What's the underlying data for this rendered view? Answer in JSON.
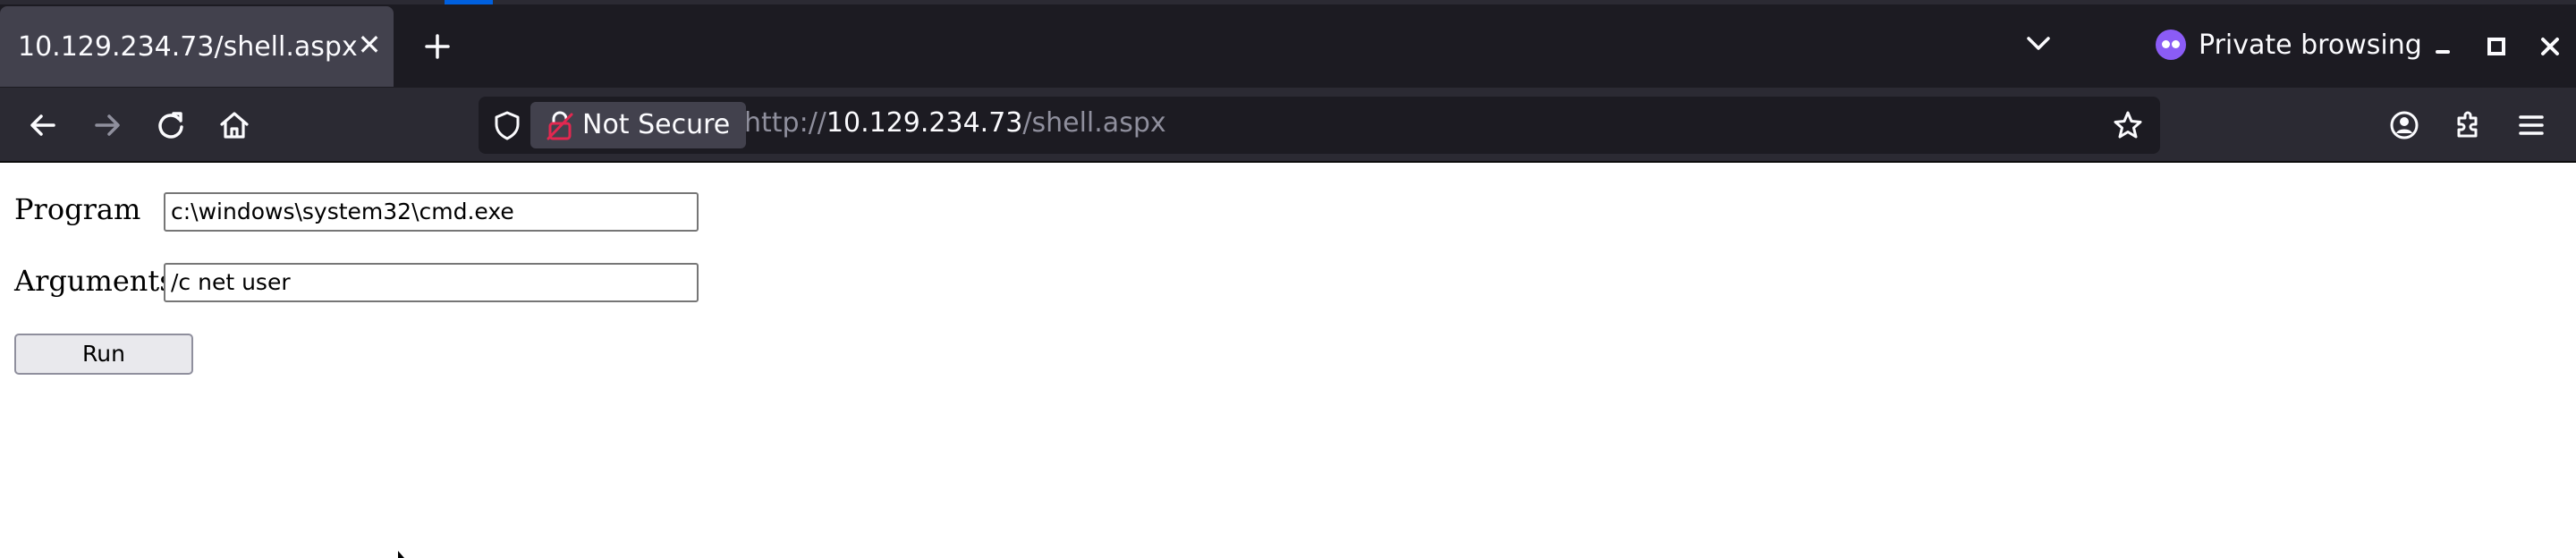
{
  "browser": {
    "tab_title": "10.129.234.73/shell.aspx",
    "private_label": "Private browsing",
    "not_secure_label": "Not Secure",
    "url_scheme": "http://",
    "url_host": "10.129.234.73",
    "url_path": "/shell.aspx",
    "icons": [
      "back-icon",
      "forward-icon",
      "reload-icon",
      "home-icon",
      "shield-icon",
      "lock-icon",
      "star-icon",
      "account-icon",
      "extensions-icon",
      "menu-icon",
      "new-tab-icon",
      "tab-list-icon",
      "minimize-icon",
      "maximize-icon",
      "close-window-icon"
    ],
    "colors": {
      "chrome_dark": "#1c1b22",
      "chrome_mid": "#2b2a33",
      "tab_active": "#42414d",
      "private_accent": "#8b5cf6",
      "insecure_lock": "#e22850"
    }
  },
  "form": {
    "program_label": "Program",
    "program_value": "c:\\windows\\system32\\cmd.exe",
    "arguments_label": "Arguments",
    "arguments_value": "/c net user",
    "run_label": "Run"
  }
}
